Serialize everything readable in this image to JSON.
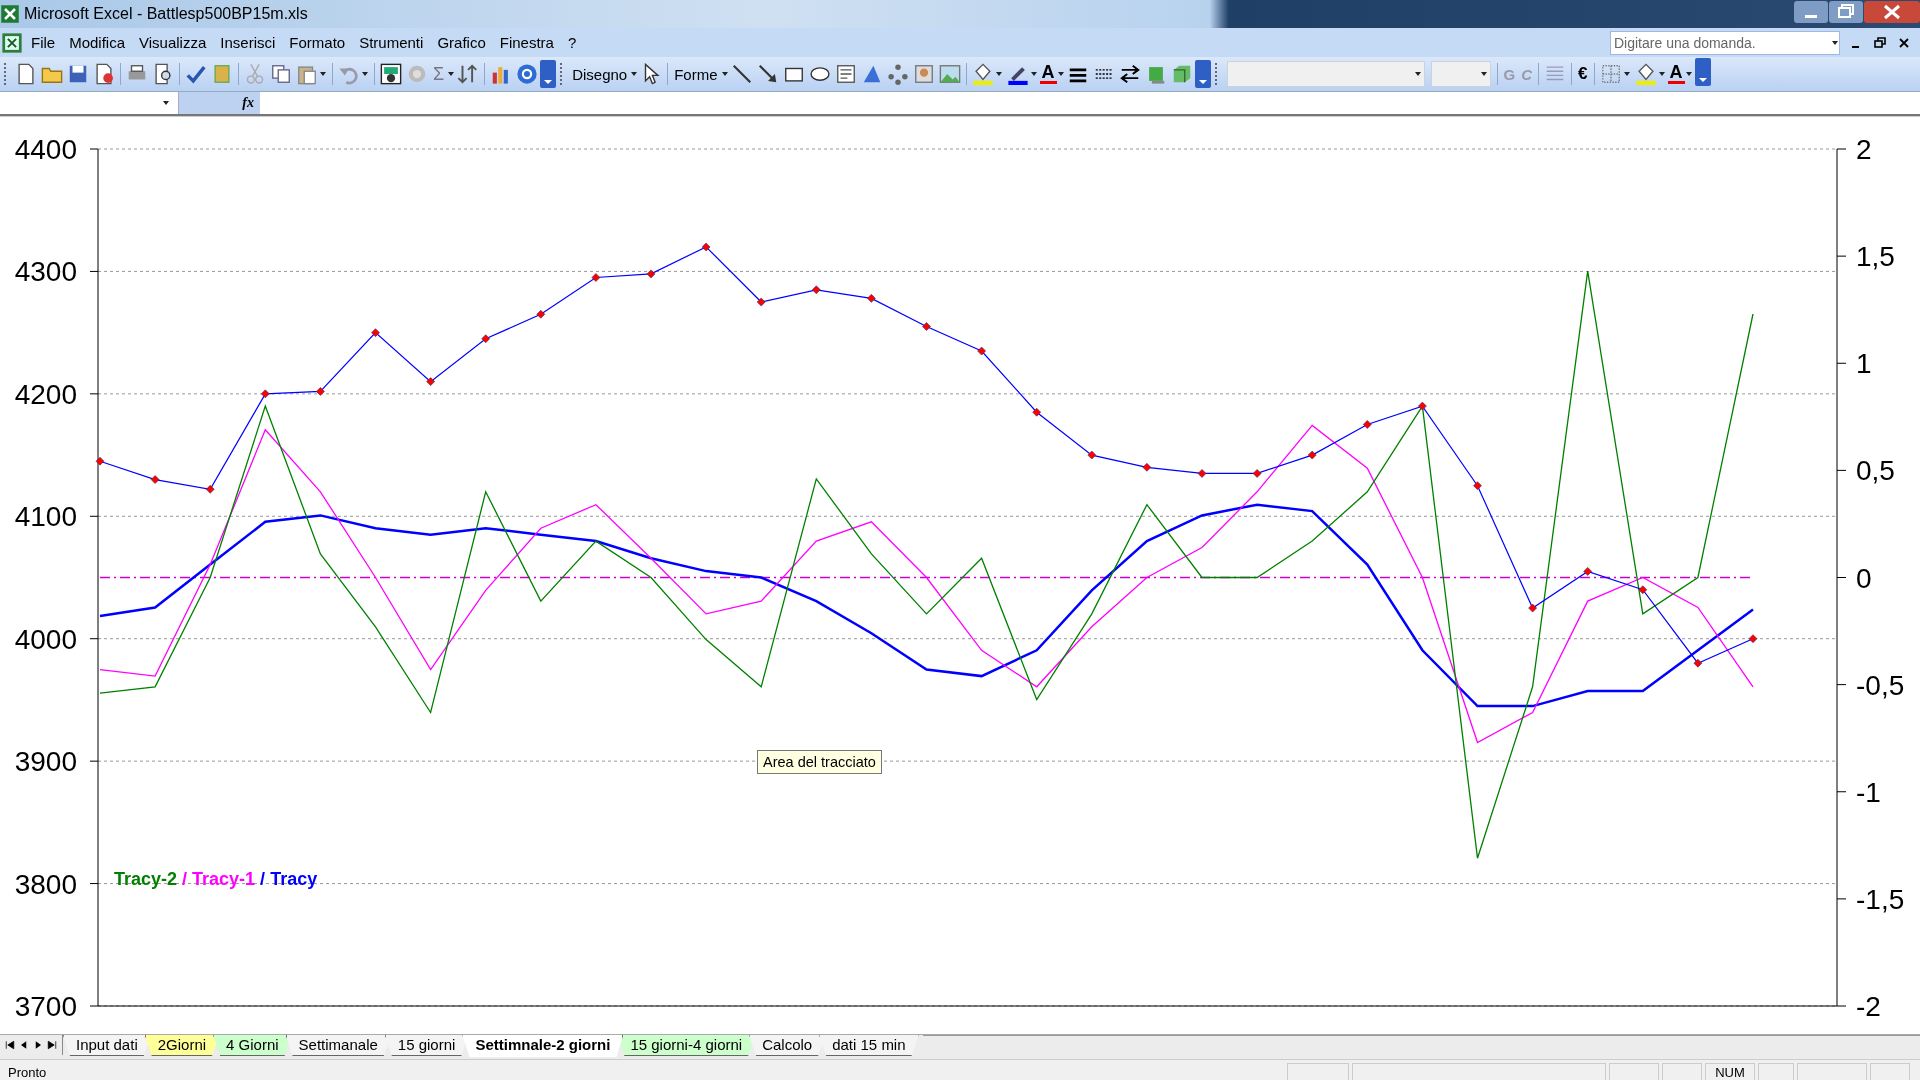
{
  "window": {
    "title": "Microsoft Excel - Battlesp500BP15m.xls"
  },
  "menu": [
    "File",
    "Modifica",
    "Visualizza",
    "Inserisci",
    "Formato",
    "Strumenti",
    "Grafico",
    "Finestra",
    "?"
  ],
  "help_search": {
    "placeholder": "Digitare una domanda."
  },
  "toolbar_labels": {
    "autosum": "Σ",
    "draw_menu": "Disegno",
    "shapes_menu": "Forme",
    "font_color": "A",
    "bold": "G",
    "italic": "C",
    "currency": "€",
    "font_color_2": "A"
  },
  "formula_bar": {
    "function_label": "fx"
  },
  "chart": {
    "tooltip": "Area del tracciato",
    "legend_separator": "/",
    "chart_data": {
      "type": "line",
      "ylim": [
        3700,
        4400
      ],
      "yticks": [
        3700,
        3800,
        3900,
        4000,
        4100,
        4200,
        4300,
        4400
      ],
      "y2lim": [
        -2,
        2
      ],
      "y2ticks": [
        {
          "value": -2,
          "label": "-2"
        },
        {
          "value": -1.5,
          "label": "-1,5"
        },
        {
          "value": -1,
          "label": "-1"
        },
        {
          "value": -0.5,
          "label": "-0,5"
        },
        {
          "value": 0,
          "label": "0"
        },
        {
          "value": 0.5,
          "label": "0,5"
        },
        {
          "value": 1,
          "label": "1"
        },
        {
          "value": 1.5,
          "label": "1,5"
        },
        {
          "value": 2,
          "label": "2"
        }
      ],
      "grid": true,
      "ref_lines": [
        {
          "axis": "y2",
          "value": 0,
          "color": "#cc00cc"
        }
      ],
      "series": [
        {
          "color": "#0000ff",
          "marker": "diamond",
          "values": [
            4145,
            4130,
            4122,
            4200,
            4202,
            4250,
            4210,
            4245,
            4265,
            4295,
            4298,
            4320,
            4275,
            4285,
            4278,
            4255,
            4235,
            4185,
            4150,
            4140,
            4135,
            4135,
            4150,
            4175,
            4190,
            4125,
            4025,
            4055,
            4040,
            3980,
            4000
          ]
        },
        {
          "name": "Tracy-2",
          "axis": "y2",
          "color": "#008000",
          "values": [
            -0.54,
            -0.51,
            0,
            0.8,
            0.11,
            -0.23,
            -0.63,
            0.4,
            -0.11,
            0.17,
            0,
            -0.29,
            -0.51,
            0.46,
            0.11,
            -0.17,
            0.09,
            -0.57,
            -0.17,
            0.34,
            0,
            0,
            0.17,
            0.4,
            0.8,
            -1.31,
            -0.51,
            1.43,
            -0.17,
            0,
            1.23
          ]
        },
        {
          "name": "Tracy-1",
          "axis": "y2",
          "color": "#ff00ff",
          "values": [
            -0.43,
            -0.46,
            0.06,
            0.69,
            0.4,
            0,
            -0.43,
            -0.06,
            0.23,
            0.34,
            0.09,
            -0.17,
            -0.11,
            0.17,
            0.26,
            0,
            -0.34,
            -0.51,
            -0.23,
            0,
            0.14,
            0.4,
            0.71,
            0.51,
            0,
            -0.77,
            -0.63,
            -0.11,
            0,
            -0.14,
            -0.51
          ]
        },
        {
          "name": "Tracy",
          "axis": "y2",
          "color": "#0000ff",
          "values": [
            -0.18,
            -0.14,
            0.06,
            0.26,
            0.29,
            0.23,
            0.2,
            0.23,
            0.2,
            0.17,
            0.09,
            0.03,
            0,
            -0.11,
            -0.26,
            -0.43,
            -0.46,
            -0.34,
            -0.06,
            0.17,
            0.29,
            0.34,
            0.31,
            0.06,
            -0.34,
            -0.6,
            -0.6,
            -0.53,
            -0.53,
            -0.34,
            -0.15
          ]
        }
      ]
    }
  },
  "sheets": [
    {
      "label": "Input dati",
      "selected": false
    },
    {
      "label": "2Giorni",
      "selected": false,
      "color": "#ffff99"
    },
    {
      "label": "4 Giorni",
      "selected": false,
      "color": "#ccffcc"
    },
    {
      "label": "Settimanale",
      "selected": false
    },
    {
      "label": "15 giorni",
      "selected": false
    },
    {
      "label": "Settimnale-2 giorni",
      "selected": true
    },
    {
      "label": "15 giorni-4 giorni",
      "selected": false,
      "color": "#ccffcc"
    },
    {
      "label": "Calcolo",
      "selected": false
    },
    {
      "label": "dati 15 min",
      "selected": false
    }
  ],
  "status_bar": {
    "status": "Pronto",
    "num_lock": "NUM"
  }
}
